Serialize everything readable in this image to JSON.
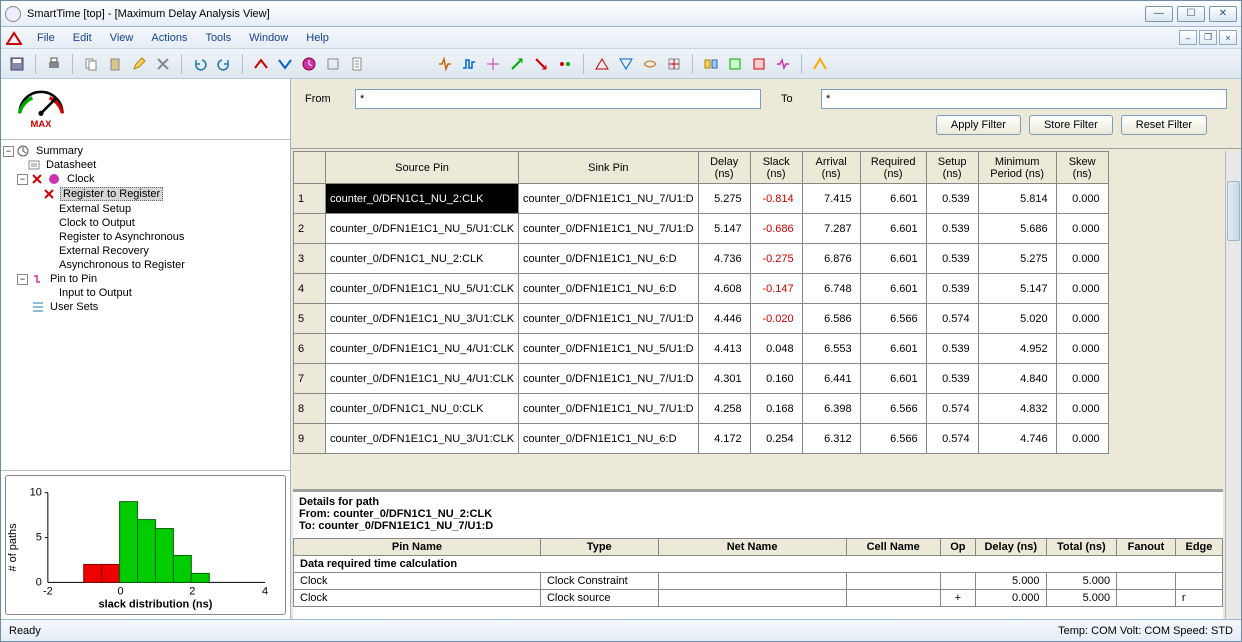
{
  "window": {
    "title": "SmartTime [top] - [Maximum Delay Analysis View]"
  },
  "menu": [
    "File",
    "Edit",
    "View",
    "Actions",
    "Tools",
    "Window",
    "Help"
  ],
  "logo_label": "MAX",
  "tree": {
    "summary": "Summary",
    "datasheet": "Datasheet",
    "clock": "Clock",
    "reg2reg": "Register to Register",
    "ext_setup": "External Setup",
    "clk2out": "Clock to Output",
    "reg2async": "Register to Asynchronous",
    "ext_rec": "External Recovery",
    "async2reg": "Asynchronous to Register",
    "pin2pin": "Pin to Pin",
    "in2out": "Input to Output",
    "usersets": "User Sets"
  },
  "filter": {
    "from_label": "From",
    "to_label": "To",
    "from_val": "*",
    "to_val": "*",
    "apply": "Apply Filter",
    "store": "Store Filter",
    "reset": "Reset Filter"
  },
  "columns": [
    "Source Pin",
    "Sink Pin",
    "Delay (ns)",
    "Slack (ns)",
    "Arrival (ns)",
    "Required (ns)",
    "Setup (ns)",
    "Minimum Period (ns)",
    "Skew (ns)"
  ],
  "rows": [
    {
      "n": "1",
      "src": "counter_0/DFN1C1_NU_2:CLK",
      "sink": "counter_0/DFN1E1C1_NU_7/U1:D",
      "delay": "5.275",
      "slack": "-0.814",
      "arr": "7.415",
      "req": "6.601",
      "setup": "0.539",
      "minp": "5.814",
      "skew": "0.000"
    },
    {
      "n": "2",
      "src": "counter_0/DFN1E1C1_NU_5/U1:CLK",
      "sink": "counter_0/DFN1E1C1_NU_7/U1:D",
      "delay": "5.147",
      "slack": "-0.686",
      "arr": "7.287",
      "req": "6.601",
      "setup": "0.539",
      "minp": "5.686",
      "skew": "0.000"
    },
    {
      "n": "3",
      "src": "counter_0/DFN1C1_NU_2:CLK",
      "sink": "counter_0/DFN1E1C1_NU_6:D",
      "delay": "4.736",
      "slack": "-0.275",
      "arr": "6.876",
      "req": "6.601",
      "setup": "0.539",
      "minp": "5.275",
      "skew": "0.000"
    },
    {
      "n": "4",
      "src": "counter_0/DFN1E1C1_NU_5/U1:CLK",
      "sink": "counter_0/DFN1E1C1_NU_6:D",
      "delay": "4.608",
      "slack": "-0.147",
      "arr": "6.748",
      "req": "6.601",
      "setup": "0.539",
      "minp": "5.147",
      "skew": "0.000"
    },
    {
      "n": "5",
      "src": "counter_0/DFN1E1C1_NU_3/U1:CLK",
      "sink": "counter_0/DFN1E1C1_NU_7/U1:D",
      "delay": "4.446",
      "slack": "-0.020",
      "arr": "6.586",
      "req": "6.566",
      "setup": "0.574",
      "minp": "5.020",
      "skew": "0.000"
    },
    {
      "n": "6",
      "src": "counter_0/DFN1E1C1_NU_4/U1:CLK",
      "sink": "counter_0/DFN1E1C1_NU_5/U1:D",
      "delay": "4.413",
      "slack": "0.048",
      "arr": "6.553",
      "req": "6.601",
      "setup": "0.539",
      "minp": "4.952",
      "skew": "0.000"
    },
    {
      "n": "7",
      "src": "counter_0/DFN1E1C1_NU_4/U1:CLK",
      "sink": "counter_0/DFN1E1C1_NU_7/U1:D",
      "delay": "4.301",
      "slack": "0.160",
      "arr": "6.441",
      "req": "6.601",
      "setup": "0.539",
      "minp": "4.840",
      "skew": "0.000"
    },
    {
      "n": "8",
      "src": "counter_0/DFN1C1_NU_0:CLK",
      "sink": "counter_0/DFN1E1C1_NU_7/U1:D",
      "delay": "4.258",
      "slack": "0.168",
      "arr": "6.398",
      "req": "6.566",
      "setup": "0.574",
      "minp": "4.832",
      "skew": "0.000"
    },
    {
      "n": "9",
      "src": "counter_0/DFN1E1C1_NU_3/U1:CLK",
      "sink": "counter_0/DFN1E1C1_NU_6:D",
      "delay": "4.172",
      "slack": "0.254",
      "arr": "6.312",
      "req": "6.566",
      "setup": "0.574",
      "minp": "4.746",
      "skew": "0.000"
    }
  ],
  "details": {
    "title": "Details for path",
    "from_lbl": "From: ",
    "from": "counter_0/DFN1C1_NU_2:CLK",
    "to_lbl": "To: ",
    "to": "counter_0/DFN1E1C1_NU_7/U1:D",
    "cols": [
      "Pin Name",
      "Type",
      "Net Name",
      "Cell Name",
      "Op",
      "Delay (ns)",
      "Total (ns)",
      "Fanout",
      "Edge"
    ],
    "section": "Data required time calculation",
    "r1": {
      "pin": "Clock",
      "type": "Clock Constraint",
      "op": "",
      "delay": "5.000",
      "total": "5.000",
      "edge": ""
    },
    "r2": {
      "pin": "Clock",
      "type": "Clock source",
      "op": "+",
      "delay": "0.000",
      "total": "5.000",
      "edge": "r"
    }
  },
  "chart": {
    "ylabel": "# of paths",
    "xlabel": "slack distribution (ns)"
  },
  "chart_data": {
    "type": "bar",
    "title": "slack distribution (ns)",
    "xlabel": "slack distribution (ns)",
    "ylabel": "# of paths",
    "xlim": [
      -2,
      4
    ],
    "ylim": [
      0,
      10
    ],
    "bin_edges": [
      -1.0,
      -0.5,
      0.0,
      0.5,
      1.0,
      1.5,
      2.0,
      2.5
    ],
    "counts": [
      2,
      2,
      9,
      7,
      6,
      3,
      1
    ],
    "colors": [
      "red",
      "red",
      "green",
      "green",
      "green",
      "green",
      "green"
    ]
  },
  "status": {
    "ready": "Ready",
    "right": "Temp: COM   Volt: COM   Speed: STD"
  }
}
